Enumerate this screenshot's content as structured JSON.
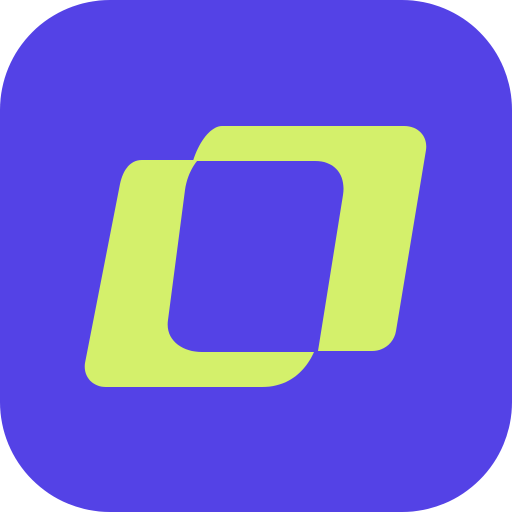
{
  "colors": {
    "background": "#ffffff",
    "tile": "#5442E6",
    "mark": "#D4F06B"
  },
  "icon": {
    "name": "app-logo-icon",
    "description_label": ""
  }
}
